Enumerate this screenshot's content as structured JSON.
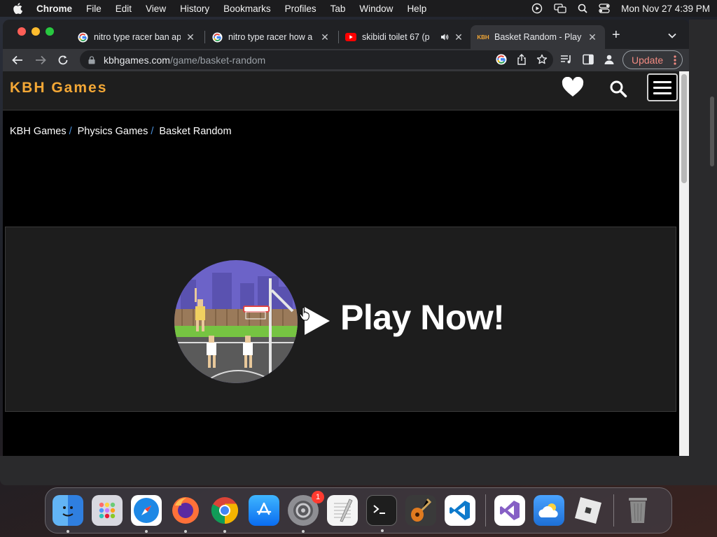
{
  "menubar": {
    "app_name": "Chrome",
    "menus": [
      "File",
      "Edit",
      "View",
      "History",
      "Bookmarks",
      "Profiles",
      "Tab",
      "Window",
      "Help"
    ],
    "clock": "Mon Nov 27  4:39 PM"
  },
  "tabs": [
    {
      "title": "nitro type racer ban ap",
      "favicon": "google-icon"
    },
    {
      "title": "nitro type racer how a",
      "favicon": "google-icon"
    },
    {
      "title": "skibidi toilet 67 (p",
      "favicon": "youtube-icon",
      "playing_audio": true
    },
    {
      "title": "Basket Random - Play",
      "favicon": "kbh-icon",
      "favicon_text": "KBH",
      "active": true
    }
  ],
  "omnibox": {
    "domain": "kbhgames.com",
    "path": "/game/basket-random"
  },
  "update_button": "Update",
  "site": {
    "logo": "KBH Games",
    "breadcrumb": [
      "KBH Games",
      "Physics Games",
      "Basket Random"
    ],
    "breadcrumb_separator": "/",
    "play_label": "Play Now!"
  },
  "dock": {
    "apps": [
      "finder-icon",
      "launchpad-icon",
      "safari-icon",
      "firefox-icon",
      "chrome-icon",
      "app-store-icon",
      "system-settings-icon",
      "textedit-icon",
      "terminal-icon",
      "garageband-icon",
      "vscode-icon"
    ],
    "recent_apps": [
      "visual-studio-icon",
      "weather-icon",
      "roblox-icon"
    ],
    "settings_badge": "1"
  },
  "colors": {
    "logo": "#f4a836",
    "breadcrumb_separator": "#4a8fd8",
    "update_text": "#f28b82"
  }
}
